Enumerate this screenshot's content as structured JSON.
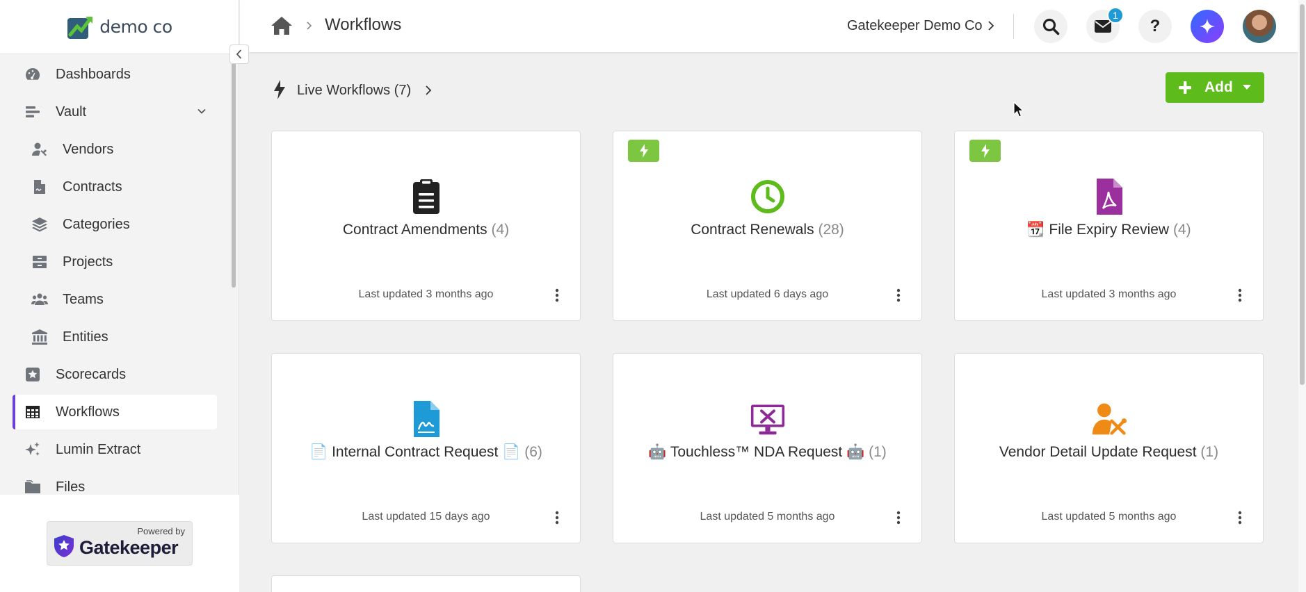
{
  "brand": {
    "name": "demo co"
  },
  "sidebar": {
    "items": [
      {
        "label": "Dashboards",
        "icon": "gauge-icon"
      },
      {
        "label": "Vault",
        "icon": "layers-bars-icon",
        "expandable": true
      },
      {
        "label": "Vendors",
        "icon": "user-tools-icon",
        "sub": true
      },
      {
        "label": "Contracts",
        "icon": "file-signature-icon",
        "sub": true
      },
      {
        "label": "Categories",
        "icon": "stack-icon",
        "sub": true
      },
      {
        "label": "Projects",
        "icon": "archive-icon",
        "sub": true
      },
      {
        "label": "Teams",
        "icon": "users-icon",
        "sub": true
      },
      {
        "label": "Entities",
        "icon": "landmark-icon",
        "sub": true
      },
      {
        "label": "Scorecards",
        "icon": "star-square-icon"
      },
      {
        "label": "Workflows",
        "icon": "table-icon",
        "active": true
      },
      {
        "label": "Lumin Extract",
        "icon": "sparkles-icon"
      },
      {
        "label": "Files",
        "icon": "folder-icon"
      }
    ],
    "powered_by": "Powered by",
    "powered_name": "Gatekeeper"
  },
  "header": {
    "title": "Workflows",
    "org": "Gatekeeper Demo Co",
    "mail_count": "1",
    "help_glyph": "?"
  },
  "toolbar": {
    "live_label": "Live Workflows (7)",
    "add_label": "Add"
  },
  "colors": {
    "accent": "#6c3fd8",
    "add_green": "#5dbb1b",
    "live_badge": "#7cc642",
    "mail_badge": "#1e9ad6"
  },
  "cards": [
    {
      "title": "Contract Amendments",
      "count": "(4)",
      "updated": "Last updated 3 months ago",
      "icon": "clipboard-list-icon",
      "live": false
    },
    {
      "title": "Contract Renewals",
      "count": "(28)",
      "updated": "Last updated 6 days ago",
      "icon": "clock-icon",
      "live": true
    },
    {
      "title": "📆 File Expiry Review",
      "count": "(4)",
      "updated": "Last updated 3 months ago",
      "icon": "file-pdf-icon",
      "live": true
    },
    {
      "title": "📄 Internal Contract Request 📄",
      "count": "(6)",
      "updated": "Last updated 15 days ago",
      "icon": "file-signature-icon",
      "live": false
    },
    {
      "title": "🤖 Touchless™ NDA Request 🤖",
      "count": "(1)",
      "updated": "Last updated 5 months ago",
      "icon": "monitor-tools-icon",
      "live": false
    },
    {
      "title": "Vendor Detail Update Request",
      "count": "(1)",
      "updated": "Last updated 5 months ago",
      "icon": "user-gear-icon",
      "live": false
    }
  ]
}
